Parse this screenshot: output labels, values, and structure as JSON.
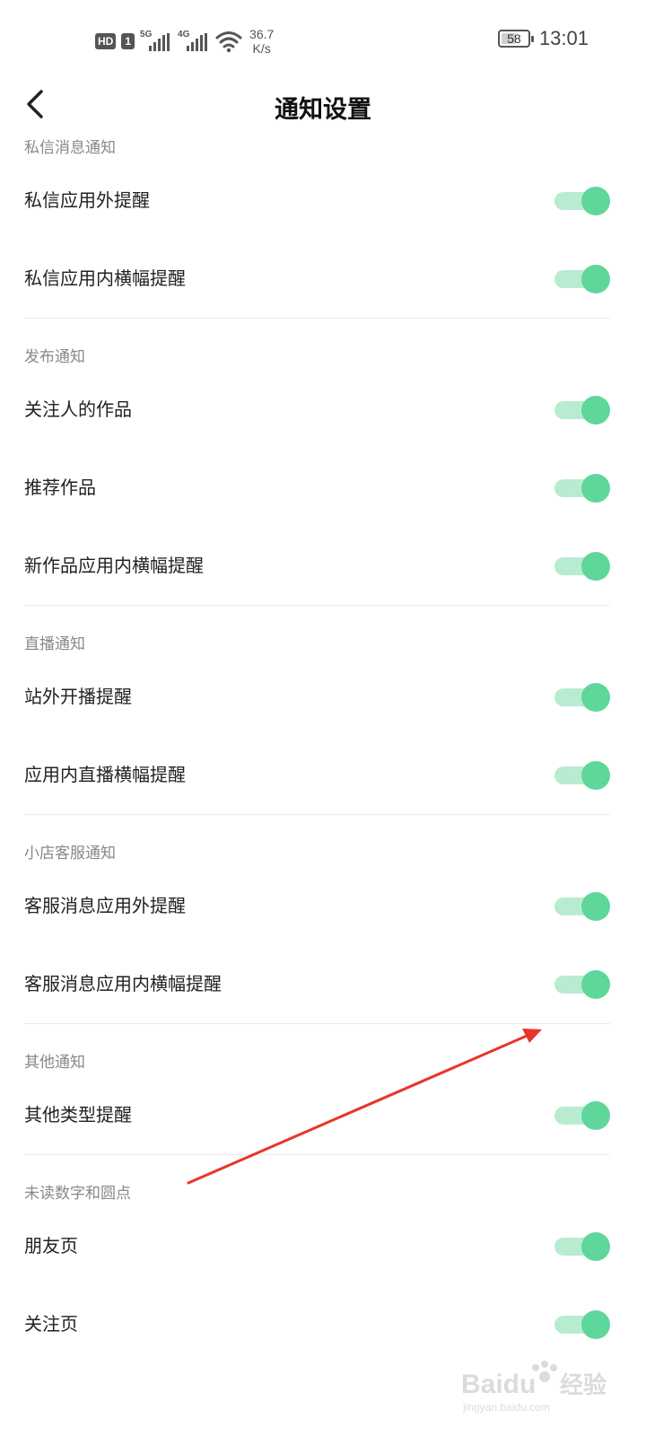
{
  "status_bar": {
    "hd": "HD",
    "sim": "1",
    "signal1_gen": "5G",
    "signal2_gen": "4G",
    "net_speed_value": "36.7",
    "net_speed_unit": "K/s",
    "battery_level": "58",
    "time": "13:01"
  },
  "header": {
    "title": "通知设置"
  },
  "sections": [
    {
      "title": "私信消息通知",
      "rows": [
        {
          "label": "私信应用外提醒",
          "enabled": true
        },
        {
          "label": "私信应用内横幅提醒",
          "enabled": true
        }
      ]
    },
    {
      "title": "发布通知",
      "rows": [
        {
          "label": "关注人的作品",
          "enabled": true
        },
        {
          "label": "推荐作品",
          "enabled": true
        },
        {
          "label": "新作品应用内横幅提醒",
          "enabled": true
        }
      ]
    },
    {
      "title": "直播通知",
      "rows": [
        {
          "label": "站外开播提醒",
          "enabled": true
        },
        {
          "label": "应用内直播横幅提醒",
          "enabled": true
        }
      ]
    },
    {
      "title": "小店客服通知",
      "rows": [
        {
          "label": "客服消息应用外提醒",
          "enabled": true
        },
        {
          "label": "客服消息应用内横幅提醒",
          "enabled": true
        }
      ]
    },
    {
      "title": "其他通知",
      "rows": [
        {
          "label": "其他类型提醒",
          "enabled": true
        }
      ]
    },
    {
      "title": "未读数字和圆点",
      "rows": [
        {
          "label": "朋友页",
          "enabled": true
        },
        {
          "label": "关注页",
          "enabled": true
        }
      ]
    }
  ],
  "colors": {
    "toggle_track_on": "#b8ecd1",
    "toggle_knob_on": "#5fd69a",
    "annotation_arrow": "#e8352b"
  },
  "icons": {
    "back": "chevron-left-icon",
    "wifi": "wifi-icon",
    "signal": "signal-bars-icon",
    "battery": "battery-icon"
  },
  "watermark": {
    "brand": "Baidu",
    "product": "经验",
    "domain": "jingyan.baidu.com"
  }
}
